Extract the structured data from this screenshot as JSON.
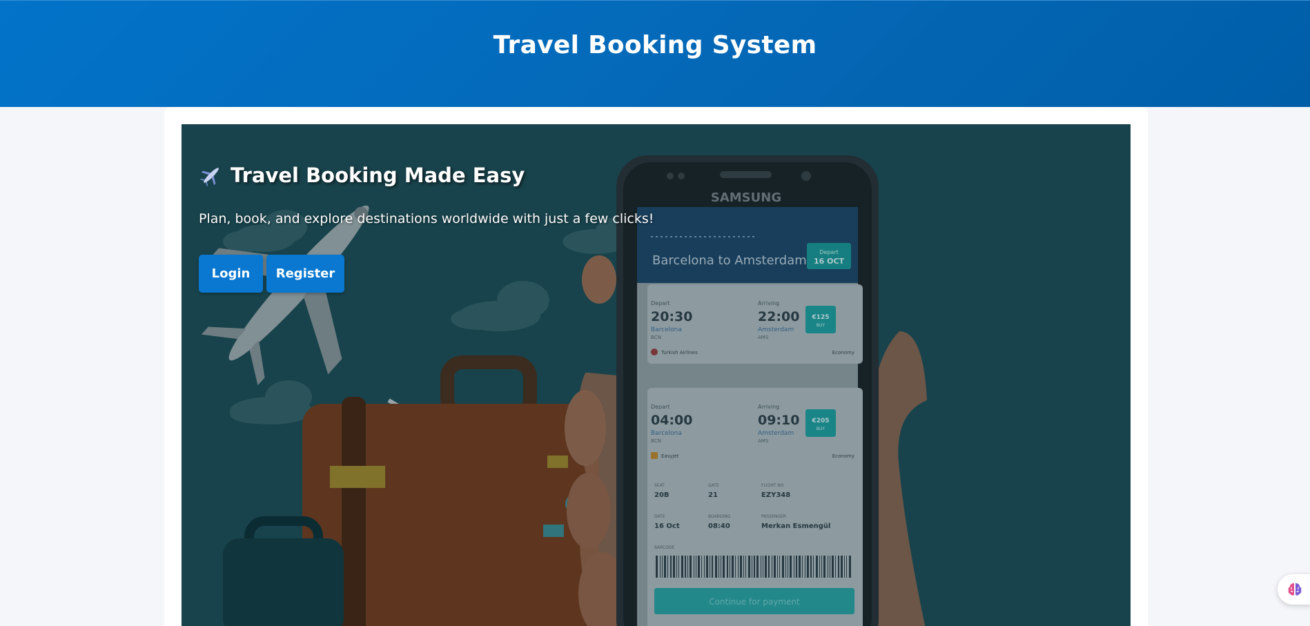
{
  "header": {
    "title": "Travel Booking System"
  },
  "hero": {
    "title": "Travel Booking Made Easy",
    "subtitle": "Plan, book, and explore destinations worldwide with just a few clicks!",
    "login_label": "Login",
    "register_label": "Register",
    "title_icon": "airplane-icon"
  },
  "phone": {
    "brand": "SAMSUNG",
    "route": "Barcelona to Amsterdam",
    "date_label": "Depart",
    "date": "16 OCT",
    "flights": [
      {
        "depart_label": "Depart",
        "depart_time": "20:30",
        "depart_city": "Barcelona",
        "depart_code": "BCN",
        "arrive_label": "Arriving",
        "arrive_time": "22:00",
        "arrive_city": "Amsterdam",
        "arrive_code": "AMS",
        "price": "€125",
        "price_sub": "BUY",
        "airline": "Turkish Airlines",
        "class": "Economy"
      },
      {
        "depart_label": "Depart",
        "depart_time": "04:00",
        "depart_city": "Barcelona",
        "depart_code": "BCN",
        "arrive_label": "Arriving",
        "arrive_time": "09:10",
        "arrive_city": "Amsterdam",
        "arrive_code": "AMS",
        "price": "€205",
        "price_sub": "BUY",
        "airline": "Easyjet",
        "class": "Economy"
      }
    ],
    "details": {
      "seat_label": "SEAT",
      "seat": "20B",
      "gate_label": "GATE",
      "gate": "21",
      "flight_label": "FLIGHT NO",
      "flight": "EZY348",
      "date_label": "DATE",
      "date": "16 Oct",
      "boarding_label": "BOARDING",
      "boarding": "08:40",
      "passenger_label": "PASSENGER",
      "passenger": "Merkan Esmengül",
      "barcode_label": "BARCODE"
    },
    "cta": "Continue for payment"
  },
  "assistant": {
    "icon": "brain-icon"
  },
  "colors": {
    "header": "#0273c9",
    "button": "#0a78d1",
    "hero_bg": "#1d4b55",
    "page_bg": "#f5f6fa"
  }
}
